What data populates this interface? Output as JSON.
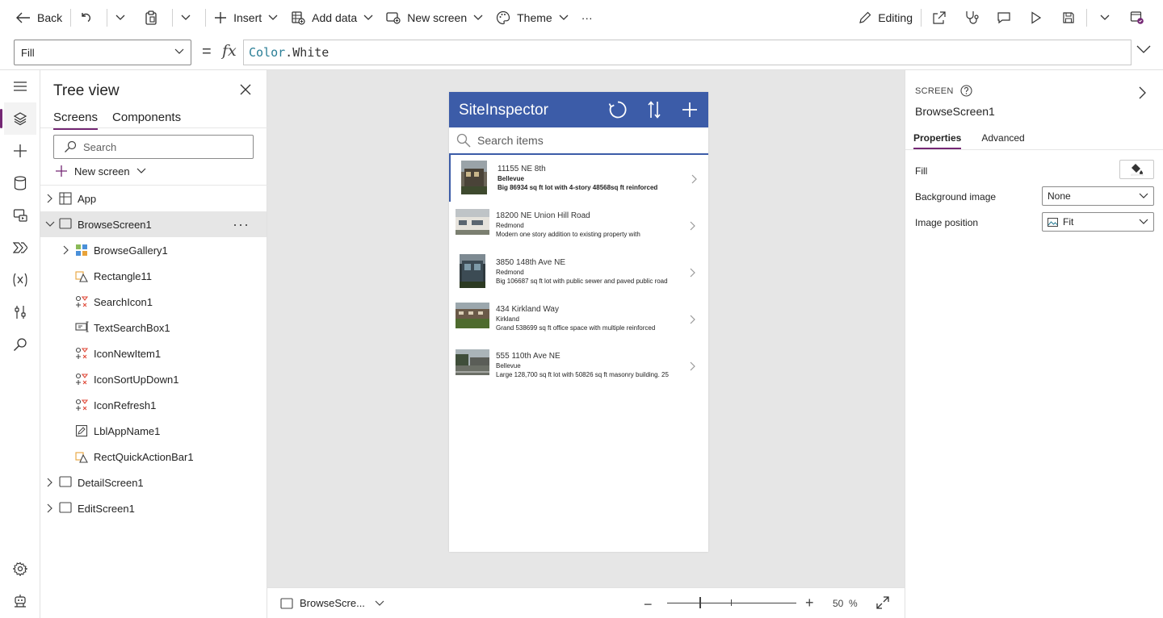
{
  "toolbar": {
    "back_label": "Back",
    "insert_label": "Insert",
    "add_data_label": "Add data",
    "new_screen_label": "New screen",
    "theme_label": "Theme",
    "more_label": "···",
    "editing_label": "Editing"
  },
  "formula_bar": {
    "property": "Fill",
    "equals": "=",
    "fx": "fx",
    "formula_object": "Color",
    "formula_dot": ".",
    "formula_member": "White"
  },
  "tree": {
    "title": "Tree view",
    "tabs": [
      "Screens",
      "Components"
    ],
    "search_placeholder": "Search",
    "new_screen_label": "New screen",
    "nodes": [
      {
        "label": "App"
      },
      {
        "label": "BrowseScreen1"
      },
      {
        "label": "BrowseGallery1"
      },
      {
        "label": "Rectangle11"
      },
      {
        "label": "SearchIcon1"
      },
      {
        "label": "TextSearchBox1"
      },
      {
        "label": "IconNewItem1"
      },
      {
        "label": "IconSortUpDown1"
      },
      {
        "label": "IconRefresh1"
      },
      {
        "label": "LblAppName1"
      },
      {
        "label": "RectQuickActionBar1"
      },
      {
        "label": "DetailScreen1"
      },
      {
        "label": "EditScreen1"
      }
    ],
    "more_label": "···"
  },
  "app_preview": {
    "app_name": "SiteInspector",
    "search_placeholder": "Search items",
    "header_color": "#3c5ca8",
    "items": [
      {
        "address": "11155 NE 8th",
        "city": "Bellevue",
        "description": "Big 86934 sq ft lot with 4-story 48568sq ft reinforced"
      },
      {
        "address": "18200 NE Union Hill Road",
        "city": "Redmond",
        "description": "Modern one story addition to existing property with"
      },
      {
        "address": "3850 148th Ave NE",
        "city": "Redmond",
        "description": "Big 106687 sq ft lot with public sewer and paved public road"
      },
      {
        "address": "434 Kirkland Way",
        "city": "Kirkland",
        "description": "Grand 538699 sq ft office space with multiple reinforced"
      },
      {
        "address": "555 110th Ave NE",
        "city": "Bellevue",
        "description": "Large 128,700 sq ft lot with 50826 sq ft masonry building. 25"
      }
    ]
  },
  "canvas_footer": {
    "screen_label": "BrowseScre...",
    "zoom_minus": "−",
    "zoom_plus": "+",
    "zoom_value": "50",
    "zoom_unit": "%"
  },
  "properties": {
    "type_label": "SCREEN",
    "name": "BrowseScreen1",
    "tabs": [
      "Properties",
      "Advanced"
    ],
    "fill_label": "Fill",
    "background_image_label": "Background image",
    "background_image_value": "None",
    "image_position_label": "Image position",
    "image_position_value": "Fit"
  },
  "colors": {
    "accent": "#742774",
    "app_header": "#3c5ca8"
  }
}
